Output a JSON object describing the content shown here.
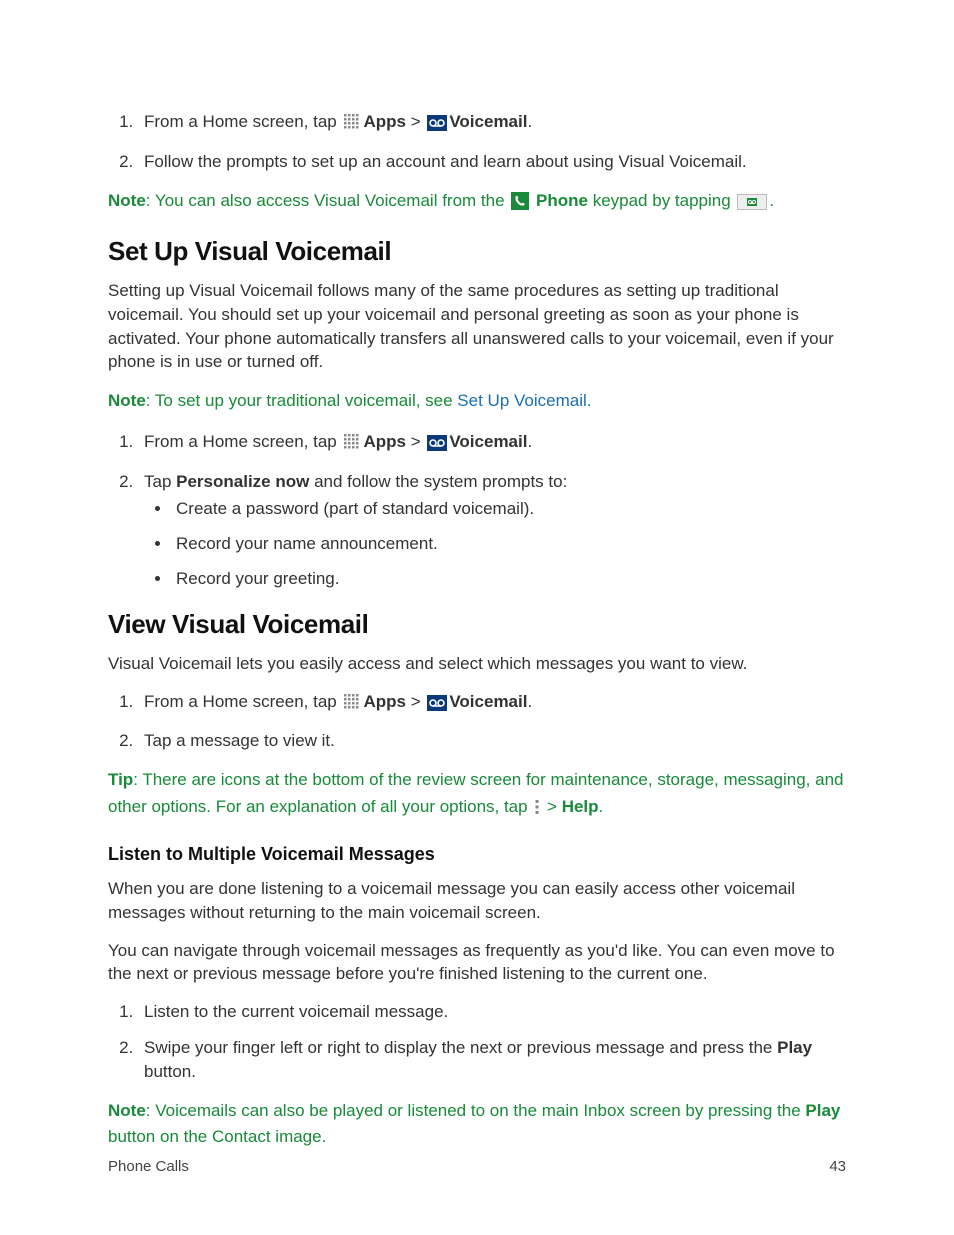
{
  "intro": {
    "step1_prefix": "From a Home screen, tap ",
    "apps_label": "Apps",
    "sep": " > ",
    "voicemail_label": "Voicemail",
    "period": ".",
    "step2": "Follow the prompts to set up an account and learn about using Visual Voicemail."
  },
  "note1": {
    "label": "Note",
    "text_a": ": You can also access Visual Voicemail from the ",
    "phone_label": "Phone",
    "text_b": " keypad by tapping ",
    "text_c": "."
  },
  "setup": {
    "heading": "Set Up Visual Voicemail",
    "para": "Setting up Visual Voicemail follows many of the same procedures as setting up traditional voicemail. You should set up your voicemail and personal greeting as soon as your phone is activated. Your phone automatically transfers all unanswered calls to your voicemail, even if your phone is in use or turned off.",
    "note_label": "Note",
    "note_a": ": To set up your traditional voicemail, see ",
    "note_link": "Set Up Voicemail",
    "note_b": ".",
    "step1_prefix": "From a Home screen, tap ",
    "apps_label": "Apps",
    "sep": " > ",
    "voicemail_label": "Voicemail",
    "period": ".",
    "step2_a": "Tap ",
    "step2_bold": "Personalize now",
    "step2_b": " and follow the system prompts to:",
    "bullets": [
      "Create a password (part of standard voicemail).",
      "Record your name announcement.",
      "Record your greeting."
    ]
  },
  "view": {
    "heading": "View Visual Voicemail",
    "para": "Visual Voicemail lets you easily access and select which messages you want to view.",
    "step1_prefix": "From a Home screen, tap ",
    "apps_label": "Apps",
    "sep": " > ",
    "voicemail_label": "Voicemail",
    "period": ".",
    "step2": "Tap a message to view it."
  },
  "tip": {
    "label": "Tip",
    "text_a": ": There are icons at the bottom of the review screen for maintenance, storage, messaging, and other options. For an explanation of all your options, tap ",
    "help_sep": " > ",
    "help_label": "Help",
    "text_b": "."
  },
  "listen": {
    "heading": "Listen to Multiple Voicemail Messages",
    "para1": "When you are done listening to a voicemail message you can easily access other voicemail messages without returning to the main voicemail screen.",
    "para2": "You can navigate through voicemail messages as frequently as you'd like. You can even move to the next or previous message before you're finished listening to the current one.",
    "step1": "Listen to the current voicemail message.",
    "step2_a": "Swipe your finger left or right to display the next or previous message and press the ",
    "step2_bold": "Play",
    "step2_b": " button."
  },
  "note2": {
    "label": "Note",
    "text_a": ": Voicemails can also be played or listened to on the main Inbox screen by pressing the ",
    "play_label": "Play",
    "text_b": " button on the Contact image."
  },
  "footer": {
    "section": "Phone Calls",
    "page_num": "43"
  }
}
